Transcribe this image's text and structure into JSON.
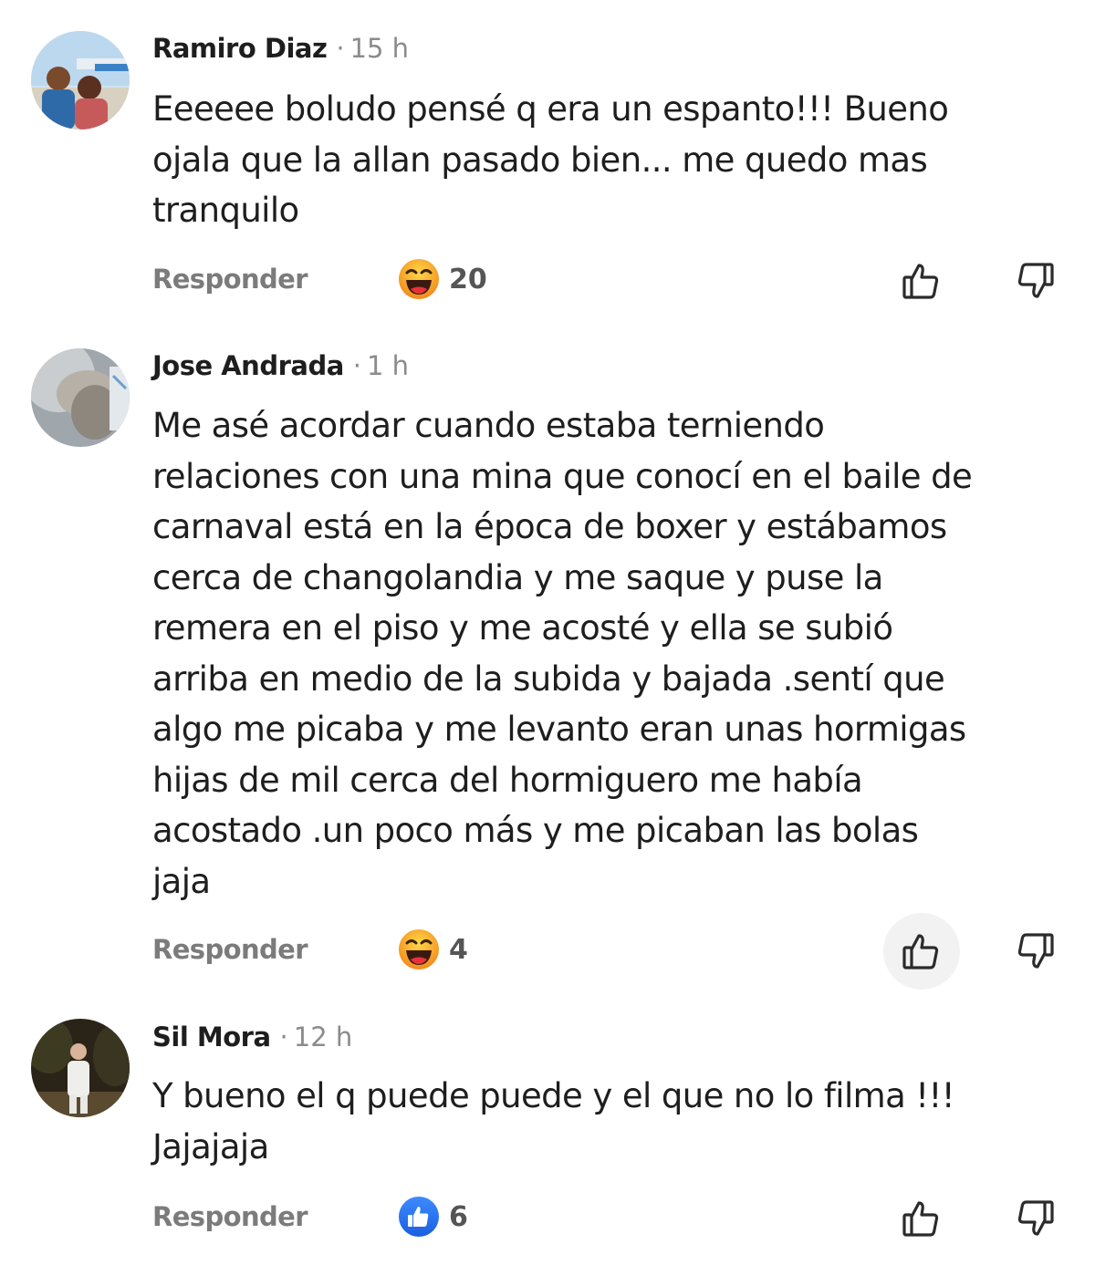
{
  "comments": [
    {
      "author": "Ramiro Diaz",
      "separator": "·",
      "time": "15 h",
      "text": "Eeeeee boludo pensé q era un espanto!!! Bueno\nojala que la allan pasado bien... me quedo mas\ntranquilo",
      "reply_label": "Responder",
      "reaction_icon": "laughing-emoji-icon",
      "reaction_count": "20"
    },
    {
      "author": "Jose Andrada",
      "separator": "·",
      "time": "1 h",
      "text": "Me asé acordar cuando estaba terniendo\nrelaciones con una mina que conocí en el baile de\ncarnaval está en la época de boxer y estábamos\ncerca de changolandia y me saque y puse la\nremera en el piso y me acosté y ella se subió\narriba en medio de la subida y bajada .sentí que\nalgo me picaba y me levanto eran unas hormigas\nhijas de mil cerca del hormiguero me había\nacostado .un poco más y me picaban las bolas\njaja",
      "reply_label": "Responder",
      "reaction_icon": "laughing-emoji-icon",
      "reaction_count": "4"
    },
    {
      "author": "Sil Mora",
      "separator": "·",
      "time": "12 h",
      "text": "Y bueno el q puede puede y el que no lo filma !!!\nJajajaja",
      "reply_label": "Responder",
      "reaction_icon": "thumbs-up-reaction-icon",
      "reaction_count": "6"
    }
  ],
  "colors": {
    "text": "#1e1e1e",
    "muted": "#7b7b7b",
    "like_blue": "#1f6ff2",
    "emoji_yellow": "#ffc42e",
    "emoji_orange": "#f28a1b"
  }
}
